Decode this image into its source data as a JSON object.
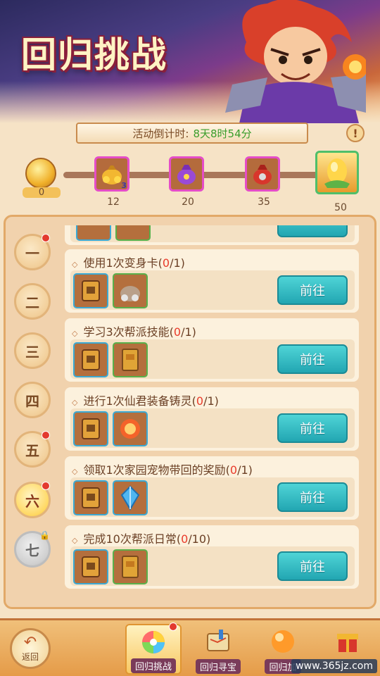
{
  "header": {
    "title": "回归挑战",
    "countdown_label": "活动倒计时:",
    "countdown_value": "8天8时54分",
    "info_icon": "info-icon"
  },
  "progress": {
    "current_score": "0",
    "milestones": [
      {
        "value": "12",
        "item": "gold-bag",
        "count": "3"
      },
      {
        "value": "20",
        "item": "purple-bag"
      },
      {
        "value": "35",
        "item": "red-gift-bag"
      },
      {
        "value": "50",
        "item": "golden-egg"
      }
    ]
  },
  "days": [
    {
      "label": "一",
      "dot": true
    },
    {
      "label": "二",
      "dot": false
    },
    {
      "label": "三",
      "dot": false
    },
    {
      "label": "四",
      "dot": false
    },
    {
      "label": "五",
      "dot": true
    },
    {
      "label": "六",
      "dot": true,
      "active": true
    },
    {
      "label": "七",
      "locked": true
    }
  ],
  "tasks": [
    {
      "title": "使用1次变身卡",
      "done": "0",
      "total": "/1)",
      "rewards": [
        "token",
        "silver-bag"
      ],
      "button": "前往"
    },
    {
      "title": "学习3次帮派技能",
      "done": "0",
      "total": "/1)",
      "rewards": [
        "token",
        "guild-book"
      ],
      "button": "前往"
    },
    {
      "title": "进行1次仙君装备铸灵",
      "done": "0",
      "total": "/1)",
      "rewards": [
        "token",
        "fire-orb"
      ],
      "button": "前往"
    },
    {
      "title": "领取1次家园宠物带回的奖励",
      "done": "0",
      "total": "/1)",
      "rewards": [
        "token",
        "blue-crystal"
      ],
      "button": "前往"
    },
    {
      "title": "完成10次帮派日常",
      "done": "0",
      "total": "/10)",
      "rewards": [
        "token",
        "guild-book"
      ],
      "button": "前往"
    }
  ],
  "bottom_nav": {
    "back_label": "返回",
    "tabs": [
      {
        "label": "回归挑战",
        "active": true,
        "dot": true
      },
      {
        "label": "回归寻宝"
      },
      {
        "label": "回归加"
      },
      {
        "label": ""
      }
    ],
    "watermark": "www.365jz.com"
  },
  "colors": {
    "accent_button": "#22a6b2",
    "progress_done": "#e93b2b",
    "panel": "#f1d2ad"
  }
}
